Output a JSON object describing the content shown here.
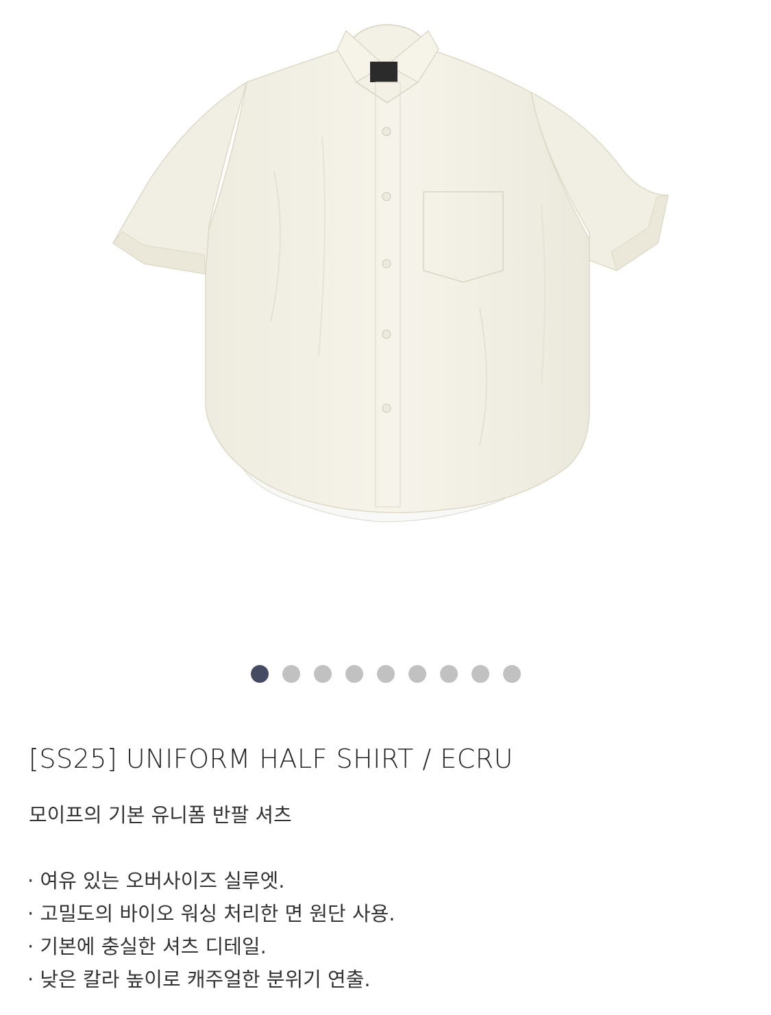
{
  "product": {
    "image_alt": "Ecru short-sleeve shirt",
    "title": "[SS25] UNIFORM HALF SHIRT / ECRU",
    "subtitle": "모이프의 기본 유니폼 반팔 셔츠",
    "features": [
      "· 여유 있는 오버사이즈 실루엣.",
      "· 고밀도의 바이오 워싱 처리한 면 원단 사용.",
      "· 기본에 충실한 셔츠 디테일.",
      "· 낮은 칼라 높이로 캐주얼한 분위기 연출."
    ]
  },
  "carousel": {
    "total": 9,
    "active_index": 0,
    "active_color": "#454b63",
    "inactive_color": "#c1c1c1"
  },
  "colors": {
    "shirt": "#f4f2e6",
    "background": "#ffffff",
    "text": "#222222"
  }
}
